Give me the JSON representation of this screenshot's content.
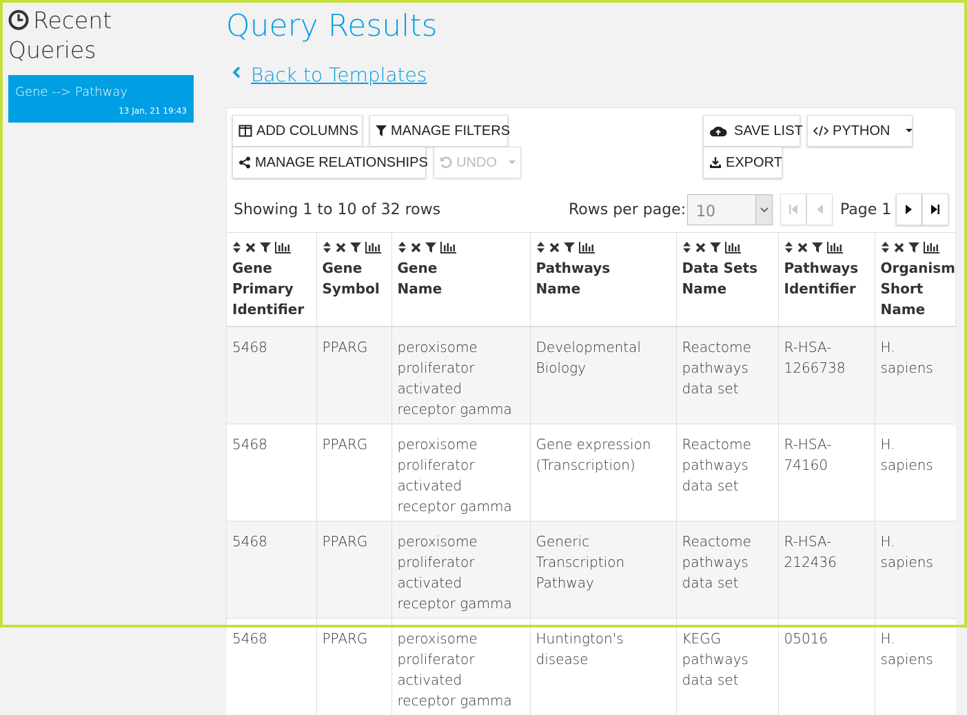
{
  "sidebar": {
    "title_line1": "Recent",
    "title_line2": "Queries",
    "queries": [
      {
        "name": "Gene --> Pathway",
        "date": "13 Jan, 21 19:43"
      }
    ]
  },
  "main": {
    "title": "Query Results",
    "back_link": "Back to Templates"
  },
  "toolbar": {
    "add_columns": "ADD COLUMNS",
    "manage_filters": "MANAGE FILTERS",
    "manage_relationships": "MANAGE RELATIONSHIPS",
    "undo": "UNDO",
    "save_list": "SAVE LIST",
    "python": "PYTHON",
    "export": "EXPORT"
  },
  "pagination": {
    "showing": "Showing 1 to 10 of 32 rows",
    "rows_per_page_label": "Rows per page:",
    "rows_per_page_value": "10",
    "page_label": "Page 1"
  },
  "table": {
    "columns": [
      [
        "Gene",
        "Primary",
        "Identifier"
      ],
      [
        "Gene",
        "Symbol"
      ],
      [
        "Gene",
        "Name"
      ],
      [
        "Pathways",
        "Name"
      ],
      [
        "Data Sets",
        "Name"
      ],
      [
        "Pathways",
        "Identifier"
      ],
      [
        "Organism",
        "Short",
        "Name"
      ]
    ],
    "rows": [
      [
        "5468",
        "PPARG",
        "peroxisome proliferator activated receptor gamma",
        "Developmental Biology",
        "Reactome pathways data set",
        "R-HSA-1266738",
        "H. sapiens"
      ],
      [
        "5468",
        "PPARG",
        "peroxisome proliferator activated receptor gamma",
        "Gene expression (Transcription)",
        "Reactome pathways data set",
        "R-HSA-74160",
        "H. sapiens"
      ],
      [
        "5468",
        "PPARG",
        "peroxisome proliferator activated receptor gamma",
        "Generic Transcription Pathway",
        "Reactome pathways data set",
        "R-HSA-212436",
        "H. sapiens"
      ],
      [
        "5468",
        "PPARG",
        "peroxisome proliferator activated receptor gamma",
        "Huntington's disease",
        "KEGG pathways data set",
        "05016",
        "H. sapiens"
      ]
    ]
  },
  "colors": {
    "accent": "#009ee2",
    "frame": "#c5df3e",
    "background": "#f2f2f2"
  },
  "icons": {
    "column_controls": [
      "sort-icon",
      "remove-column-icon",
      "filter-icon",
      "summary-chart-icon"
    ]
  }
}
